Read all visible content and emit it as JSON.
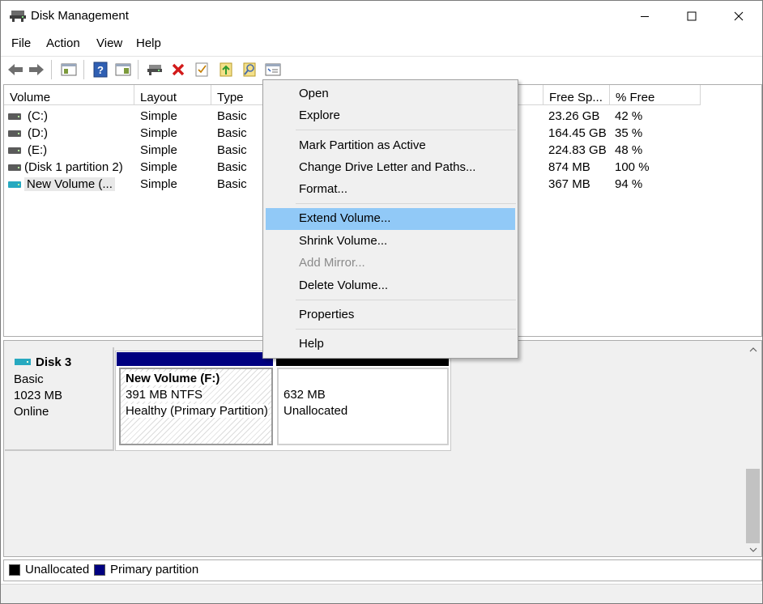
{
  "window": {
    "title": "Disk Management"
  },
  "menubar": {
    "items": [
      "File",
      "Action",
      "View",
      "Help"
    ]
  },
  "toolbar": {
    "buttons": [
      "back-icon",
      "forward-icon",
      "up-folder-icon",
      "help-icon",
      "show-hide-icon",
      "drive-icon",
      "delete-icon",
      "properties-icon",
      "open-icon",
      "explore-icon",
      "settings-icon"
    ]
  },
  "volume_table": {
    "columns": [
      "Volume",
      "Layout",
      "Type",
      "Free Sp...",
      "% Free"
    ],
    "rows": [
      {
        "volume": "(C:)",
        "layout": "Simple",
        "type": "Basic",
        "free": "23.26 GB",
        "pct": "42 %"
      },
      {
        "volume": "(D:)",
        "layout": "Simple",
        "type": "Basic",
        "free": "164.45 GB",
        "pct": "35 %"
      },
      {
        "volume": "(E:)",
        "layout": "Simple",
        "type": "Basic",
        "free": "224.83 GB",
        "pct": "48 %"
      },
      {
        "volume": "(Disk 1 partition 2)",
        "layout": "Simple",
        "type": "Basic",
        "free": "874 MB",
        "pct": "100 %"
      },
      {
        "volume": "New Volume (...",
        "layout": "Simple",
        "type": "Basic",
        "free": "367 MB",
        "pct": "94 %"
      }
    ]
  },
  "disk": {
    "name": "Disk 3",
    "type": "Basic",
    "size": "1023 MB",
    "status": "Online",
    "partitions": [
      {
        "name": "New Volume  (F:)",
        "size_fs": "391 MB NTFS",
        "status": "Healthy (Primary Partition)"
      },
      {
        "size": "632 MB",
        "status": "Unallocated"
      }
    ]
  },
  "legend": {
    "unallocated": "Unallocated",
    "primary": "Primary partition"
  },
  "context_menu": {
    "items": [
      "Open",
      "Explore",
      "Mark Partition as Active",
      "Change Drive Letter and Paths...",
      "Format...",
      "Extend Volume...",
      "Shrink Volume...",
      "Add Mirror...",
      "Delete Volume...",
      "Properties",
      "Help"
    ],
    "highlighted": "Extend Volume...",
    "disabled": "Add Mirror..."
  },
  "colors": {
    "primary_partition": "#000080",
    "unallocated": "#000000",
    "highlight": "#91c9f7"
  }
}
